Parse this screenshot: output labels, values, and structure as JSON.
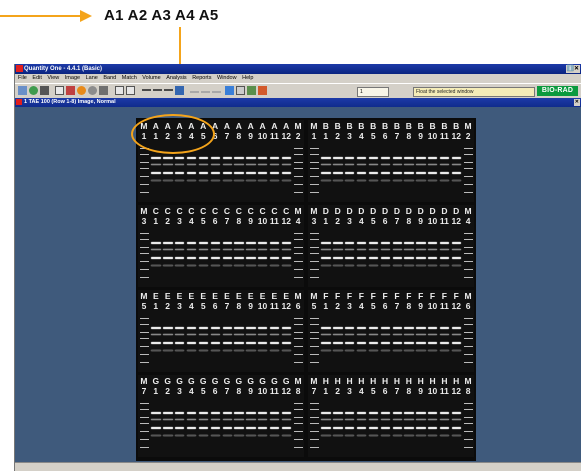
{
  "callout": {
    "label": "A1  A2  A3  A4  A5",
    "color": "#f4a41b"
  },
  "window": {
    "title": "Quantity One - 4.4.1 (Basic)",
    "controls": "ℹ️✕",
    "menus": [
      "File",
      "Edit",
      "View",
      "Image",
      "Lane",
      "Band",
      "Match",
      "Volume",
      "Analysis",
      "Reports",
      "Window",
      "Help"
    ],
    "toolbar_value": "1",
    "status_hint": "Float the selected window",
    "logo": "BIO-RAD"
  },
  "document": {
    "title": "1 TAE 100 (Row 1-8) Image, Normal",
    "controls": "✕"
  },
  "gel": {
    "rows": [
      {
        "top": [
          "M",
          "A",
          "A",
          "A",
          "A",
          "A",
          "A",
          "A",
          "A",
          "A",
          "A",
          "A",
          "A",
          "M",
          "M",
          "B",
          "B",
          "B",
          "B",
          "B",
          "B",
          "B",
          "B",
          "B",
          "B",
          "B",
          "B",
          "M"
        ],
        "bottom": [
          "1",
          "1",
          "2",
          "3",
          "4",
          "5",
          "6",
          "7",
          "8",
          "9",
          "10",
          "11",
          "12",
          "2",
          "1",
          "1",
          "2",
          "3",
          "4",
          "5",
          "6",
          "7",
          "8",
          "9",
          "10",
          "11",
          "12",
          "2"
        ]
      },
      {
        "top": [
          "M",
          "C",
          "C",
          "C",
          "C",
          "C",
          "C",
          "C",
          "C",
          "C",
          "C",
          "C",
          "C",
          "M",
          "M",
          "D",
          "D",
          "D",
          "D",
          "D",
          "D",
          "D",
          "D",
          "D",
          "D",
          "D",
          "D",
          "M"
        ],
        "bottom": [
          "3",
          "1",
          "2",
          "3",
          "4",
          "5",
          "6",
          "7",
          "8",
          "9",
          "10",
          "11",
          "12",
          "4",
          "3",
          "1",
          "2",
          "3",
          "4",
          "5",
          "6",
          "7",
          "8",
          "9",
          "10",
          "11",
          "12",
          "4"
        ]
      },
      {
        "top": [
          "M",
          "E",
          "E",
          "E",
          "E",
          "E",
          "E",
          "E",
          "E",
          "E",
          "E",
          "E",
          "E",
          "M",
          "M",
          "F",
          "F",
          "F",
          "F",
          "F",
          "F",
          "F",
          "F",
          "F",
          "F",
          "F",
          "F",
          "M"
        ],
        "bottom": [
          "5",
          "1",
          "2",
          "3",
          "4",
          "5",
          "6",
          "7",
          "8",
          "9",
          "10",
          "11",
          "12",
          "6",
          "5",
          "1",
          "2",
          "3",
          "4",
          "5",
          "6",
          "7",
          "8",
          "9",
          "10",
          "11",
          "12",
          "6"
        ]
      },
      {
        "top": [
          "M",
          "G",
          "G",
          "G",
          "G",
          "G",
          "G",
          "G",
          "G",
          "G",
          "G",
          "G",
          "G",
          "M",
          "M",
          "H",
          "H",
          "H",
          "H",
          "H",
          "H",
          "H",
          "H",
          "H",
          "H",
          "H",
          "H",
          "M"
        ],
        "bottom": [
          "7",
          "1",
          "2",
          "3",
          "4",
          "5",
          "6",
          "7",
          "8",
          "9",
          "10",
          "11",
          "12",
          "8",
          "7",
          "1",
          "2",
          "3",
          "4",
          "5",
          "6",
          "7",
          "8",
          "9",
          "10",
          "11",
          "12",
          "8"
        ]
      }
    ]
  }
}
